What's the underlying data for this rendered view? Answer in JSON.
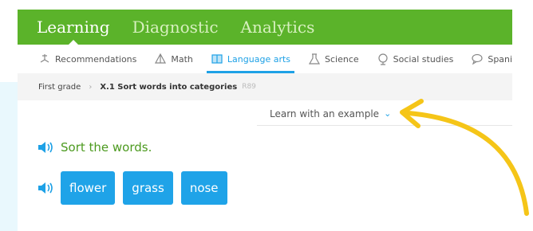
{
  "top_tabs": [
    {
      "label": "Learning"
    },
    {
      "label": "Diagnostic"
    },
    {
      "label": "Analytics"
    }
  ],
  "subnav": [
    {
      "label": "Recommendations",
      "icon": "recommendations-icon"
    },
    {
      "label": "Math",
      "icon": "math-icon"
    },
    {
      "label": "Language arts",
      "icon": "book-icon"
    },
    {
      "label": "Science",
      "icon": "science-icon"
    },
    {
      "label": "Social studies",
      "icon": "globe-icon"
    },
    {
      "label": "Spani",
      "icon": "chat-icon"
    }
  ],
  "breadcrumb": {
    "grade": "First grade",
    "skill": "X.1 Sort words into categories",
    "code": "R89"
  },
  "example": {
    "label": "Learn with an example"
  },
  "prompt": {
    "text": "Sort the words."
  },
  "words": [
    "flower",
    "grass",
    "nose"
  ],
  "colors": {
    "top_bar": "#5bb32a",
    "accent_blue": "#1ea1e6",
    "prompt_green": "#4c9a1f",
    "annotation_arrow": "#f5c518"
  }
}
